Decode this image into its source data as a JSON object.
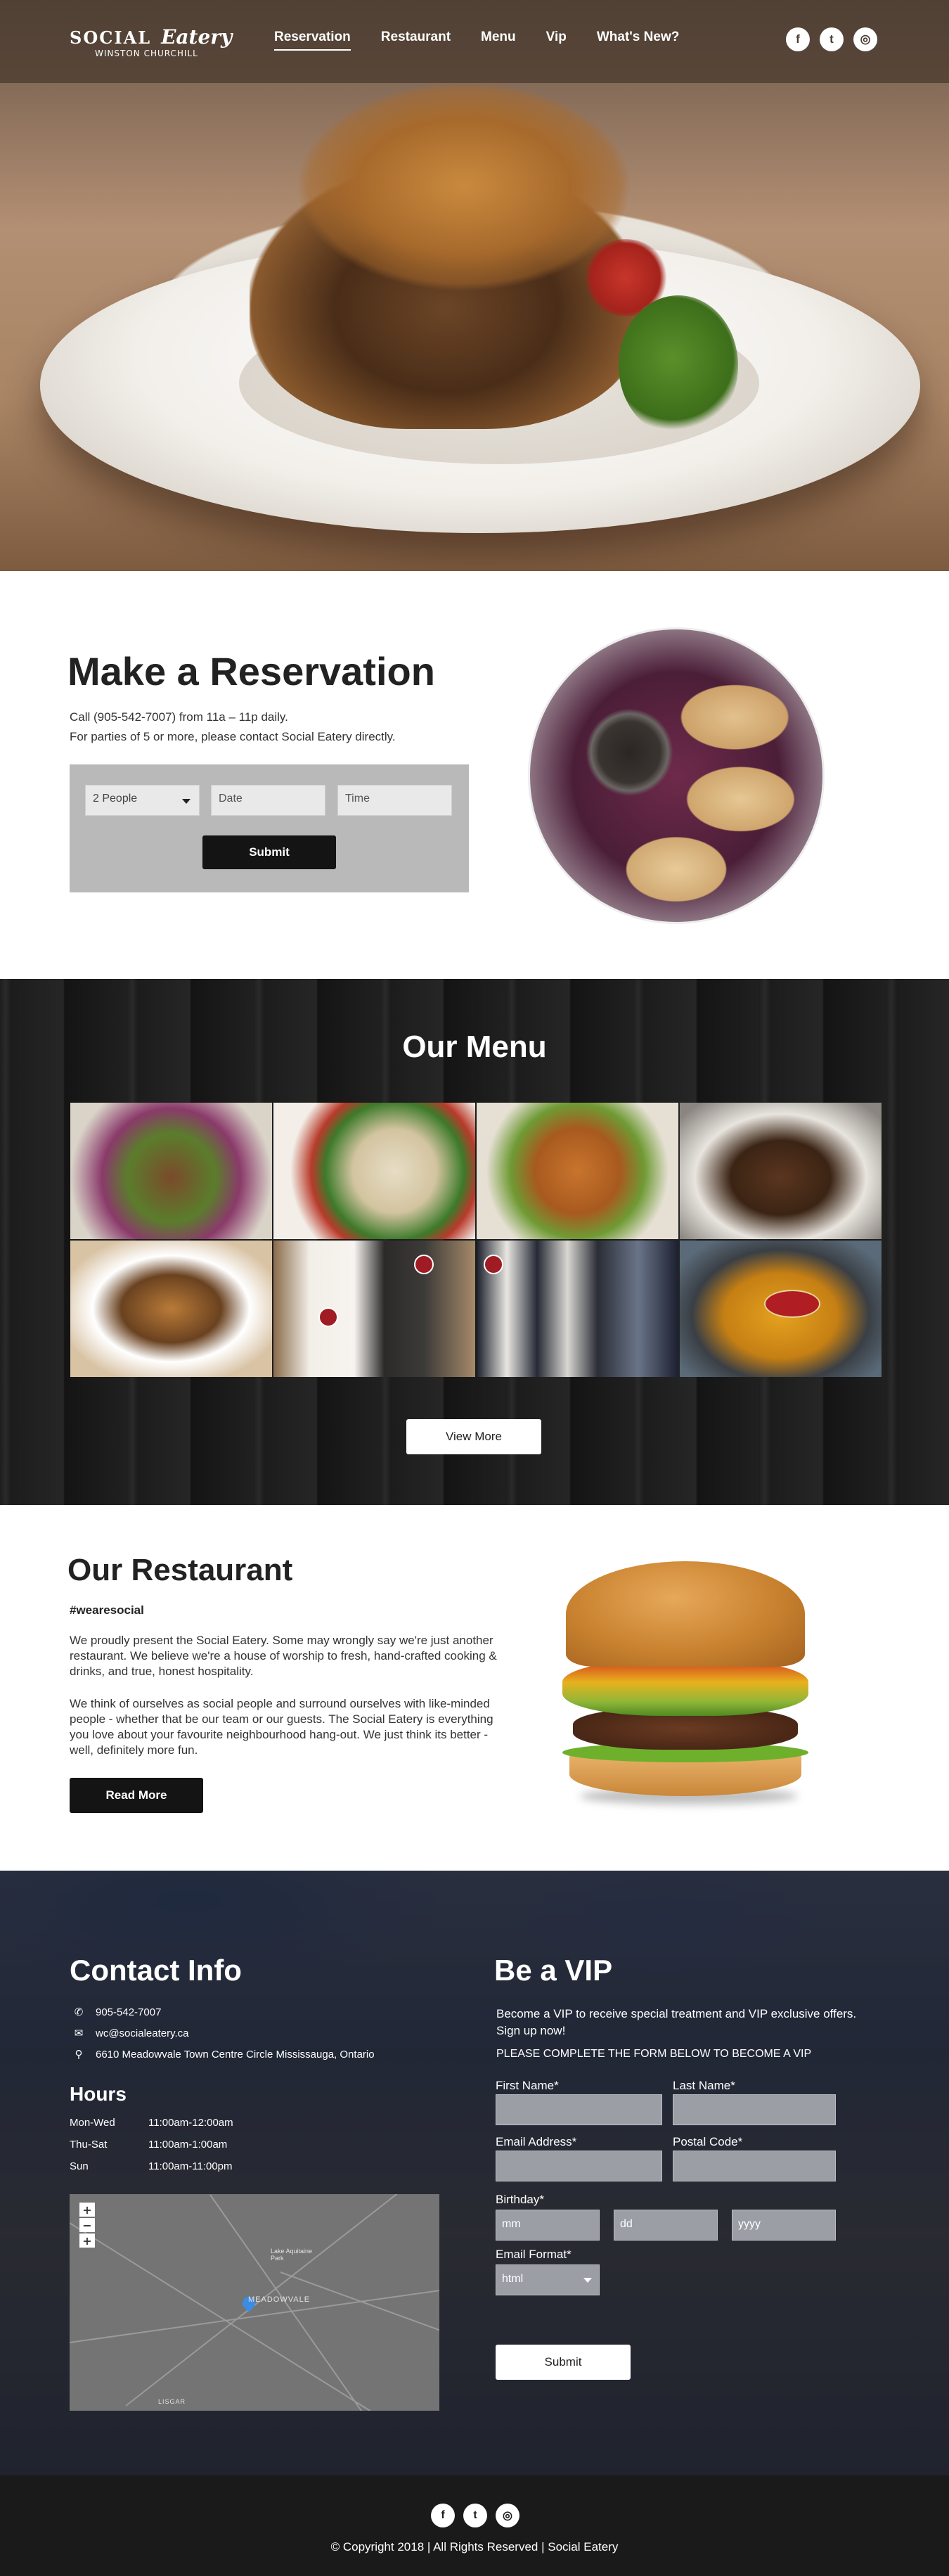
{
  "header": {
    "logo": {
      "word1": "SOCIAL",
      "word2": "Eatery",
      "tagline": "WINSTON CHURCHILL"
    },
    "nav": [
      {
        "label": "Reservation",
        "active": true
      },
      {
        "label": "Restaurant"
      },
      {
        "label": "Menu"
      },
      {
        "label": "Vip"
      },
      {
        "label": "What's New?"
      }
    ],
    "social": [
      {
        "icon": "facebook-icon",
        "glyph": "f"
      },
      {
        "icon": "twitter-icon",
        "glyph": "t"
      },
      {
        "icon": "instagram-icon",
        "glyph": "◎"
      }
    ]
  },
  "reservation": {
    "title": "Make a Reservation",
    "line1": "Call (905-542-7007) from 11a – 11p daily.",
    "line2": "For parties of 5 or more, please contact Social Eatery directly.",
    "people_value": "2 People",
    "date_placeholder": "Date",
    "time_placeholder": "Time",
    "submit_label": "Submit"
  },
  "menu": {
    "title": "Our Menu",
    "view_more_label": "View More"
  },
  "restaurant": {
    "title": "Our Restaurant",
    "tag": "#wearesocial",
    "p1": "We proudly present the Social Eatery. Some may wrongly say we're just another restaurant. We believe we're a house of worship to fresh, hand-crafted cooking & drinks, and true, honest hospitality.",
    "p2": "We think of ourselves as social people and surround ourselves with like-minded people - whether that be our team or our guests. The Social Eatery is everything you love about your favourite neighbourhood hang-out. We just think its better - well, definitely more fun.",
    "read_more_label": "Read More"
  },
  "contact": {
    "title": "Contact Info",
    "phone": "905-542-7007",
    "email": "wc@socialeatery.ca",
    "address": "6610 Meadowvale Town Centre Circle Mississauga, Ontario",
    "hours_title": "Hours",
    "hours": [
      {
        "days": "Mon-Wed",
        "time": "11:00am-12:00am"
      },
      {
        "days": "Thu-Sat",
        "time": "11:00am-1:00am"
      },
      {
        "days": "Sun",
        "time": "11:00am-11:00pm"
      }
    ],
    "map": {
      "zoom_in": "+",
      "zoom_out": "−",
      "reset": "+",
      "label_area": "MEADOWVALE",
      "label_park": "Lake Aquitaine Park",
      "label_street": "LISGAR"
    }
  },
  "vip": {
    "title": "Be a VIP",
    "intro": "Become a VIP to receive special treatment and VIP exclusive offers. Sign up now!",
    "instruction": "PLEASE COMPLETE THE FORM BELOW TO BECOME A VIP",
    "first_name_label": "First Name*",
    "last_name_label": "Last Name*",
    "email_label": "Email Address*",
    "postal_label": "Postal Code*",
    "birthday_label": "Birthday*",
    "mm_placeholder": "mm",
    "dd_placeholder": "dd",
    "yyyy_placeholder": "yyyy",
    "format_label": "Email Format*",
    "format_value": "html",
    "submit_label": "Submit"
  },
  "footer": {
    "copyright": "© Copyright 2018 | All Rights Reserved | Social Eatery"
  }
}
